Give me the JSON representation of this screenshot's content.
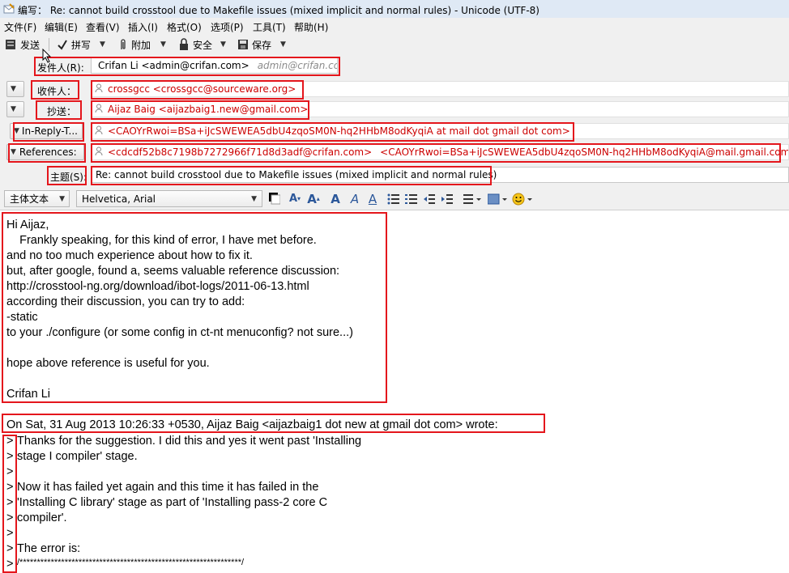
{
  "window": {
    "title_prefix": "编写：",
    "title": "Re: cannot build crosstool due to Makefile issues (mixed implicit and normal rules) - Unicode (UTF-8)"
  },
  "menu": [
    "文件(F)",
    "编辑(E)",
    "查看(V)",
    "插入(I)",
    "格式(O)",
    "选项(P)",
    "工具(T)",
    "帮助(H)"
  ],
  "toolbar": {
    "send": "发送",
    "spell": "拼写",
    "attach": "附加",
    "security": "安全",
    "save": "保存"
  },
  "header": {
    "from_label": "发件人(R):",
    "from_name": "Crifan Li <admin@crifan.com>",
    "from_identity": "admin@crifan.com",
    "to_label": "收件人：",
    "to_value": "crossgcc <crossgcc@sourceware.org>",
    "cc_label": "抄送：",
    "cc_value": "Aijaz Baig <aijazbaig1.new@gmail.com>",
    "inreply_label": "In-Reply-T...",
    "inreply_value": "<CAOYrRwoi=BSa+iJcSWEWEA5dbU4zqoSM0N-hq2HHbM8odKyqiA at mail dot gmail dot com>",
    "refs_label": "References:",
    "refs_value1": "<cdcdf52b8c7198b7272966f71d8d3adf@crifan.com>",
    "refs_value2": "<CAOYrRwoi=BSa+iJcSWEWEA5dbU4zqoSM0N-hq2HHbM8odKyqiA@mail.gmail.com>",
    "subject_label": "主题(S):",
    "subject_value": "Re: cannot build crosstool due to Makefile issues (mixed implicit and normal rules)"
  },
  "format": {
    "paragraph_style": "主体文本",
    "font": "Helvetica, Arial"
  },
  "body": {
    "reply_lines": [
      "Hi Aijaz,",
      "    Frankly speaking, for this kind of error, I have met before.",
      "and no too much experience about how to fix it.",
      "but, after google, found a, seems valuable reference discussion:",
      "http://crosstool-ng.org/download/ibot-logs/2011-06-13.html",
      "according their discussion, you can try to add:",
      "-static",
      "to your ./configure (or some config in ct-nt menuconfig? not sure...)",
      "",
      "hope above reference is useful for you.",
      "",
      "Crifan Li"
    ],
    "attribution": "On Sat, 31 Aug 2013 10:26:33 +0530, Aijaz Baig <aijazbaig1 dot new at gmail dot com> wrote:",
    "quote_marks": [
      ">",
      ">",
      ">",
      ">",
      ">",
      ">",
      ">",
      ">",
      ">"
    ],
    "quoted_lines": [
      "Thanks for the suggestion. I did this and yes it went past 'Installing",
      "stage I compiler' stage.",
      "",
      "Now it has failed yet again and this time it has failed in the",
      "'Installing C library' stage as part of 'Installing pass-2 core C",
      "compiler'.",
      "",
      "The error is:",
      "/****************************************************************/"
    ]
  },
  "colors": {
    "highlight_box": "#e4161c",
    "address": "#cc0000",
    "identity": "#8c8c8c",
    "format_icon": "#2b579a"
  }
}
